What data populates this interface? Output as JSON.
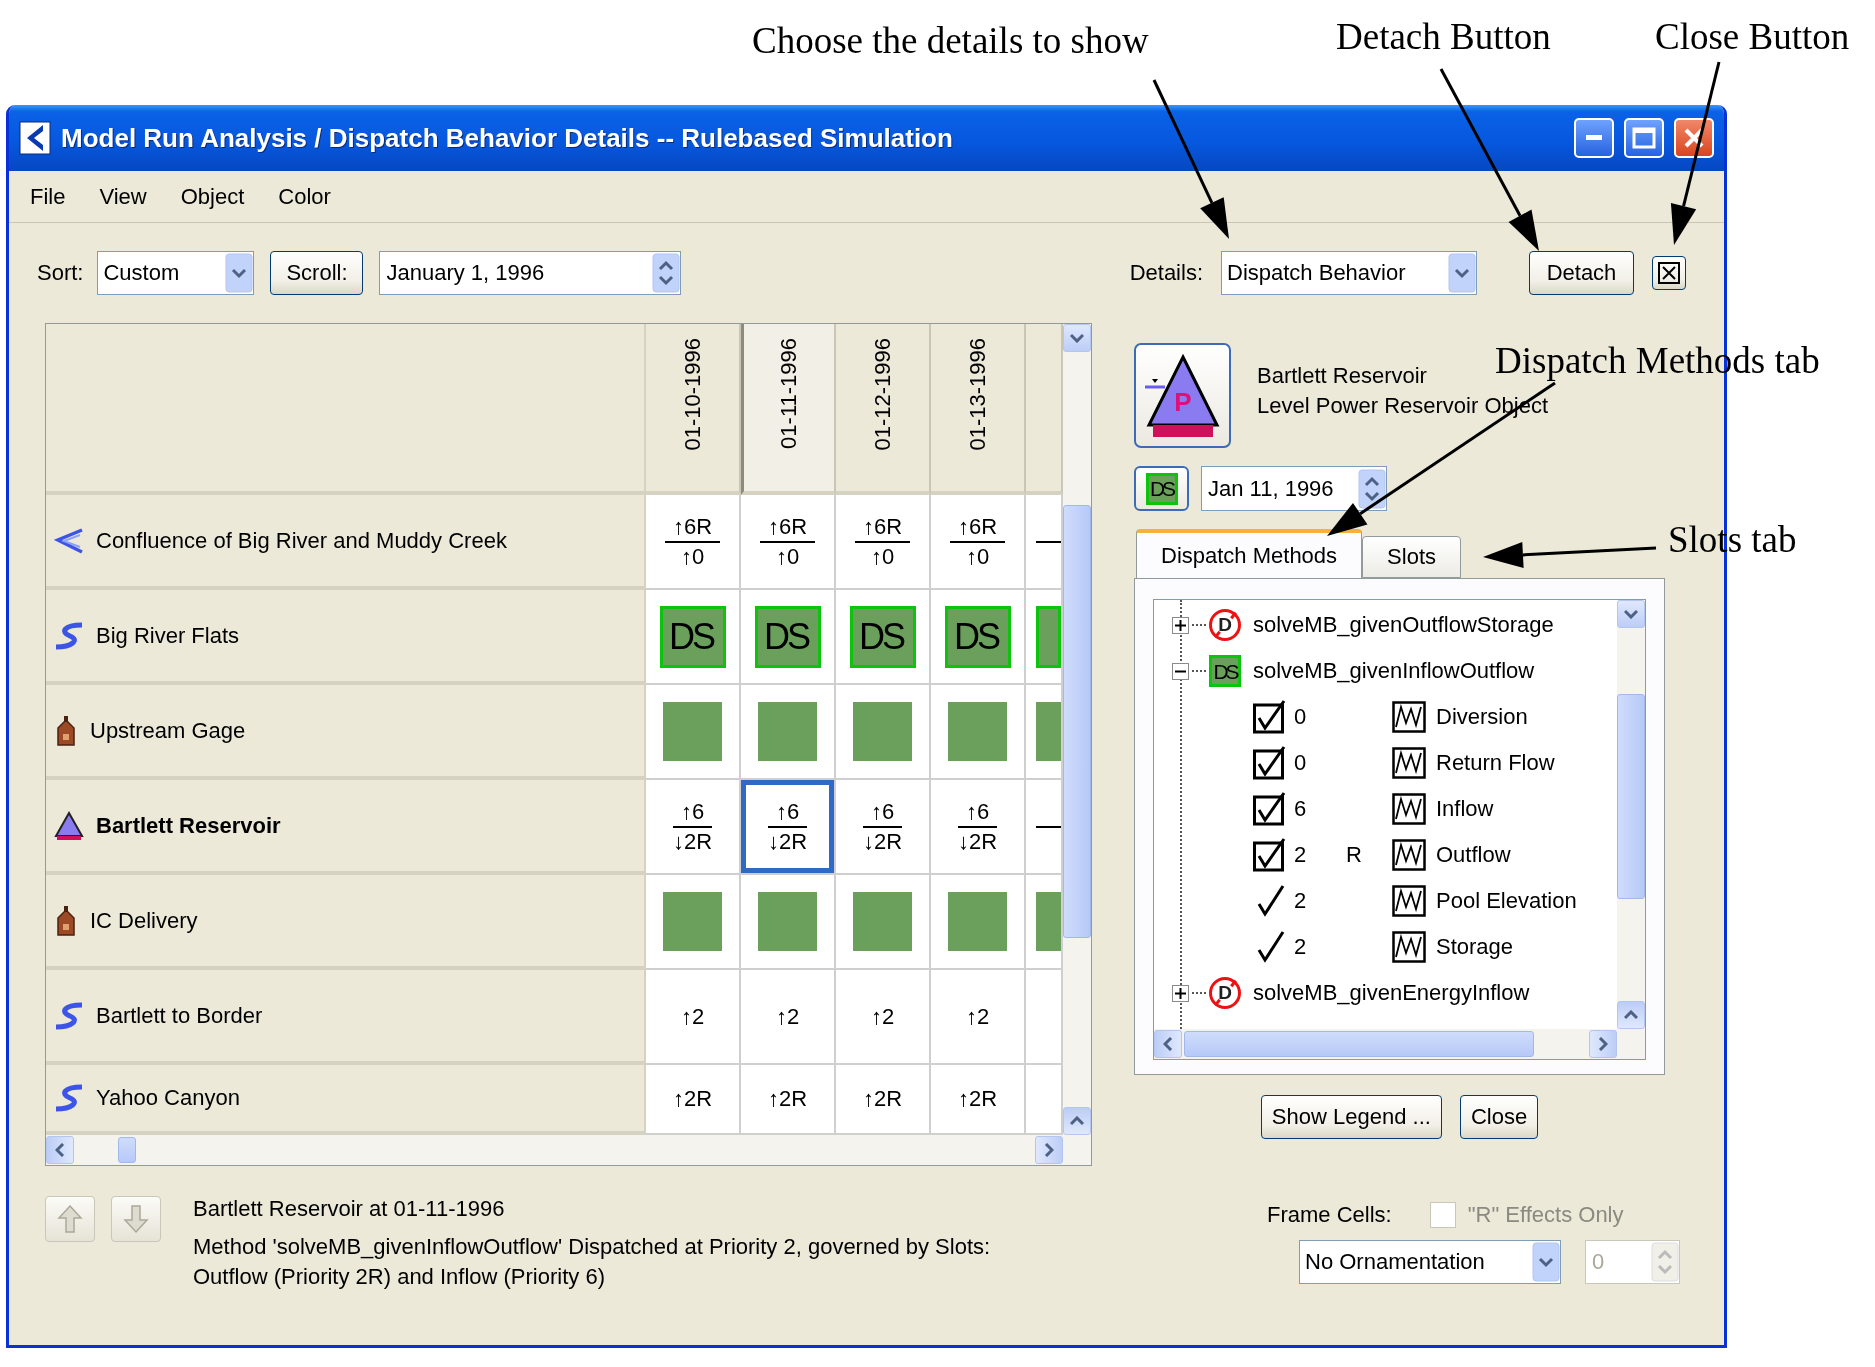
{
  "callouts": [
    "Choose the details to show",
    "Detach Button",
    "Close Button",
    "Dispatch Methods tab",
    "Slots tab"
  ],
  "window": {
    "title": "Model Run Analysis / Dispatch Behavior Details -- Rulebased Simulation"
  },
  "menu": [
    "File",
    "View",
    "Object",
    "Color"
  ],
  "toolbar": {
    "sort_label": "Sort:",
    "sort_value": "Custom",
    "scroll_button": "Scroll:",
    "date": "January 1, 1996",
    "details_label": "Details:",
    "details_value": "Dispatch Behavior",
    "detach_button": "Detach"
  },
  "grid": {
    "columns": [
      {
        "label": "01-10-1996",
        "selected": false
      },
      {
        "label": "01-11-1996",
        "selected": true
      },
      {
        "label": "01-12-1996",
        "selected": false
      },
      {
        "label": "01-13-1996",
        "selected": false
      }
    ],
    "rows": [
      {
        "name": "Confluence of Big River and Muddy Creek",
        "kind": "confluence",
        "selected": false,
        "cells": [
          {
            "kind": "fraction",
            "top": "↑6R",
            "bottom": "↑0",
            "selected": false
          },
          {
            "kind": "fraction",
            "top": "↑6R",
            "bottom": "↑0",
            "selected": false
          },
          {
            "kind": "fraction",
            "top": "↑6R",
            "bottom": "↑0",
            "selected": false
          },
          {
            "kind": "fraction",
            "top": "↑6R",
            "bottom": "↑0",
            "selected": false
          },
          {
            "kind": "fraction",
            "selected": false
          }
        ]
      },
      {
        "name": "Big River Flats",
        "kind": "reach",
        "selected": false,
        "cells": [
          {
            "kind": "ds",
            "label": "DS",
            "selected": false
          },
          {
            "kind": "ds",
            "label": "DS",
            "selected": false
          },
          {
            "kind": "ds",
            "label": "DS",
            "selected": false
          },
          {
            "kind": "ds",
            "label": "DS",
            "selected": false
          },
          {
            "kind": "ds",
            "selected": false
          }
        ]
      },
      {
        "name": "Upstream Gage",
        "kind": "gage",
        "selected": false,
        "cells": [
          {
            "kind": "block",
            "selected": false
          },
          {
            "kind": "block",
            "selected": false
          },
          {
            "kind": "block",
            "selected": false
          },
          {
            "kind": "block",
            "selected": false
          },
          {
            "kind": "block",
            "selected": false
          }
        ]
      },
      {
        "name": "Bartlett Reservoir",
        "kind": "reservoir",
        "selected": true,
        "cells": [
          {
            "kind": "fraction",
            "top": "↑6",
            "bottom": "↓2R",
            "selected": false
          },
          {
            "kind": "fraction",
            "top": "↑6",
            "bottom": "↓2R",
            "selected": true
          },
          {
            "kind": "fraction",
            "top": "↑6",
            "bottom": "↓2R",
            "selected": false
          },
          {
            "kind": "fraction",
            "top": "↑6",
            "bottom": "↓2R",
            "selected": false
          },
          {
            "kind": "fraction",
            "selected": false
          }
        ]
      },
      {
        "name": "IC Delivery",
        "kind": "gage",
        "selected": false,
        "cells": [
          {
            "kind": "block",
            "selected": false
          },
          {
            "kind": "block",
            "selected": false
          },
          {
            "kind": "block",
            "selected": false
          },
          {
            "kind": "block",
            "selected": false
          },
          {
            "kind": "block",
            "selected": false
          }
        ]
      },
      {
        "name": "Bartlett to Border",
        "kind": "reach",
        "selected": false,
        "cells": [
          {
            "kind": "single",
            "text": "↑2",
            "selected": false
          },
          {
            "kind": "single",
            "text": "↑2",
            "selected": false
          },
          {
            "kind": "single",
            "text": "↑2",
            "selected": false
          },
          {
            "kind": "single",
            "text": "↑2",
            "selected": false
          },
          {
            "kind": "empty",
            "selected": false
          }
        ]
      },
      {
        "name": "Yahoo Canyon",
        "kind": "reach",
        "selected": false,
        "cells": [
          {
            "kind": "single",
            "text": "↑2R",
            "selected": false
          },
          {
            "kind": "single",
            "text": "↑2R",
            "selected": false
          },
          {
            "kind": "single",
            "text": "↑2R",
            "selected": false
          },
          {
            "kind": "single",
            "text": "↑2R",
            "selected": false
          },
          {
            "kind": "empty",
            "selected": false
          }
        ]
      }
    ]
  },
  "object": {
    "name": "Bartlett Reservoir",
    "type": "Level Power Reservoir Object",
    "icon_label": "P"
  },
  "dispatch_badge": "DS",
  "date": "Jan 11, 1996",
  "tabs": [
    {
      "label": "Dispatch Methods",
      "selected": true
    },
    {
      "label": "Slots",
      "selected": false
    }
  ],
  "methods": [
    {
      "name": "solveMB_givenOutflowStorage",
      "badge": "D",
      "dispatched": false,
      "expanded": false
    },
    {
      "name": "solveMB_givenInflowOutflow",
      "badge": "DS",
      "dispatched": true,
      "expanded": true,
      "children": [
        {
          "kind": "boxed",
          "priority": "0",
          "slot": "Diversion"
        },
        {
          "kind": "boxed",
          "priority": "0",
          "slot": "Return Flow"
        },
        {
          "kind": "boxed",
          "priority": "6",
          "slot": "Inflow"
        },
        {
          "kind": "boxed",
          "priority": "2",
          "flag": "R",
          "slot": "Outflow"
        },
        {
          "kind": "plain",
          "priority": "2",
          "slot": "Pool Elevation"
        },
        {
          "kind": "plain",
          "priority": "2",
          "slot": "Storage"
        }
      ]
    },
    {
      "name": "solveMB_givenEnergyInflow",
      "badge": "D",
      "dispatched": false,
      "expanded": false
    }
  ],
  "buttons": [
    "Show Legend ...",
    "Close"
  ],
  "nav_buttons": [
    {
      "kind": "up",
      "disabled": true
    },
    {
      "kind": "down",
      "disabled": true
    }
  ],
  "status": {
    "title": "Bartlett Reservoir at 01-11-1996",
    "message": "Method 'solveMB_givenInflowOutflow' Dispatched at Priority 2, governed by Slots:\nOutflow (Priority 2R) and Inflow (Priority 6)"
  },
  "frame_cells": {
    "label": "Frame Cells:",
    "r_effects_only": {
      "label": "\"R\" Effects Only",
      "checked": false,
      "disabled": true
    },
    "ornamentation": "No Ornamentation",
    "spinner": {
      "value": "0",
      "disabled": true
    }
  }
}
